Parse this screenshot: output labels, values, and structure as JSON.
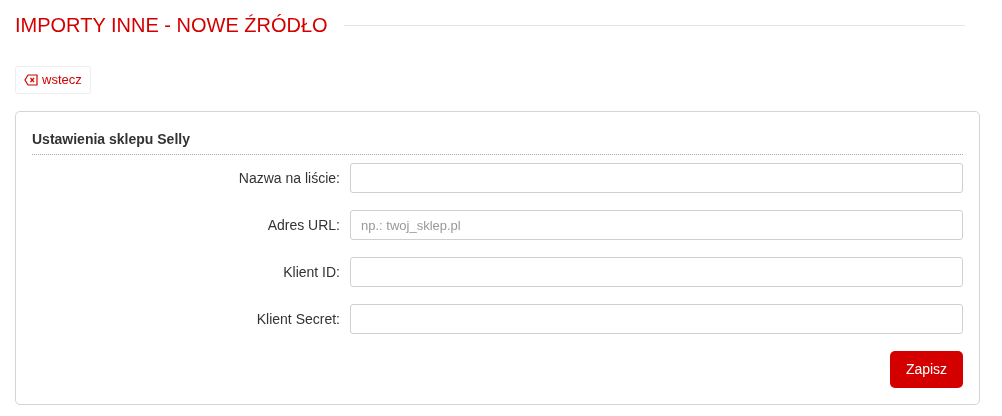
{
  "page_title": "IMPORTY INNE - NOWE ŹRÓDŁO",
  "back_button": {
    "label": "wstecz"
  },
  "panel": {
    "title": "Ustawienia sklepu Selly",
    "fields": [
      {
        "label": "Nazwa na liście:"
      },
      {
        "label": "Adres URL:",
        "placeholder": "np.: twoj_sklep.pl"
      },
      {
        "label": "Klient ID:"
      },
      {
        "label": "Klient Secret:"
      }
    ],
    "submit_button": "Zapisz"
  }
}
